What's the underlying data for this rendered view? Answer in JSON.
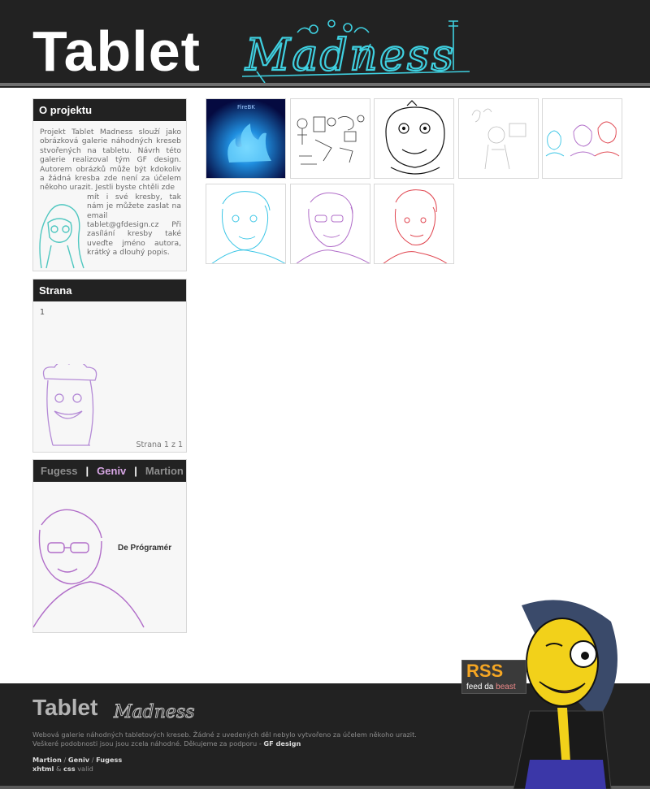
{
  "header": {
    "logo_word": "Tablet",
    "logo_script": "Madness"
  },
  "about": {
    "title": "O projektu",
    "text_top": "Projekt Tablet Madness slouží jako obrázková galerie náhodných kreseb stvořených na tabletu. Návrh této galerie realizoval tým GF design. Autorem obrázků může být kdokoliv a žádná kresba zde není za účelem někoho urazit. Jestli byste chtěli zde",
    "text_bottom": "mít i své kresby, tak nám je můžete zaslat na email tablet@gfdesign.cz Při zasílání kresby také uveďte jméno autora, krátký a dlouhý popis."
  },
  "strana": {
    "title": "Strana",
    "current": "1",
    "footer": "Strana 1 z 1"
  },
  "team": {
    "tabs": [
      "Fugess",
      "Geniv",
      "Martion"
    ],
    "separator": "|",
    "active_tab": "Geniv",
    "role": "De Prógramér"
  },
  "gallery": {
    "thumbnails": [
      {
        "name": "thumb-blue-fire"
      },
      {
        "name": "thumb-sketch-scene"
      },
      {
        "name": "thumb-character-face"
      },
      {
        "name": "thumb-faint-sketch"
      },
      {
        "name": "thumb-three-portraits"
      },
      {
        "name": "thumb-cyan-portrait"
      },
      {
        "name": "thumb-purple-portrait"
      },
      {
        "name": "thumb-red-portrait"
      }
    ],
    "thumb_label": "FireBK"
  },
  "footer": {
    "logo_word": "Tablet",
    "logo_script": "Madness",
    "desc_line1": "Webová galerie náhodných tabletových kreseb. Žádné z uvedených děl nebylo vytvořeno za účelem někoho urazit.",
    "desc_line2": "Veškeré podobnosti jsou jsou zcela náhodné. Děkujeme za podporu - ",
    "desc_sponsor": "GF design",
    "credit_1": "Martion",
    "credit_2": "Geniv",
    "credit_3": "Fugess",
    "credit_sep": "/",
    "valid_1": "xhtml",
    "valid_and": "&",
    "valid_2": "css",
    "valid_suffix": "valid"
  },
  "rss": {
    "label": "RSS",
    "sub_prefix": "feed da ",
    "sub_highlight": "beast"
  },
  "colors": {
    "header_bg": "#222222",
    "logo_script": "#3fd0e0",
    "tab_active": "#d7a6e4",
    "rss_orange": "#f5a623"
  }
}
